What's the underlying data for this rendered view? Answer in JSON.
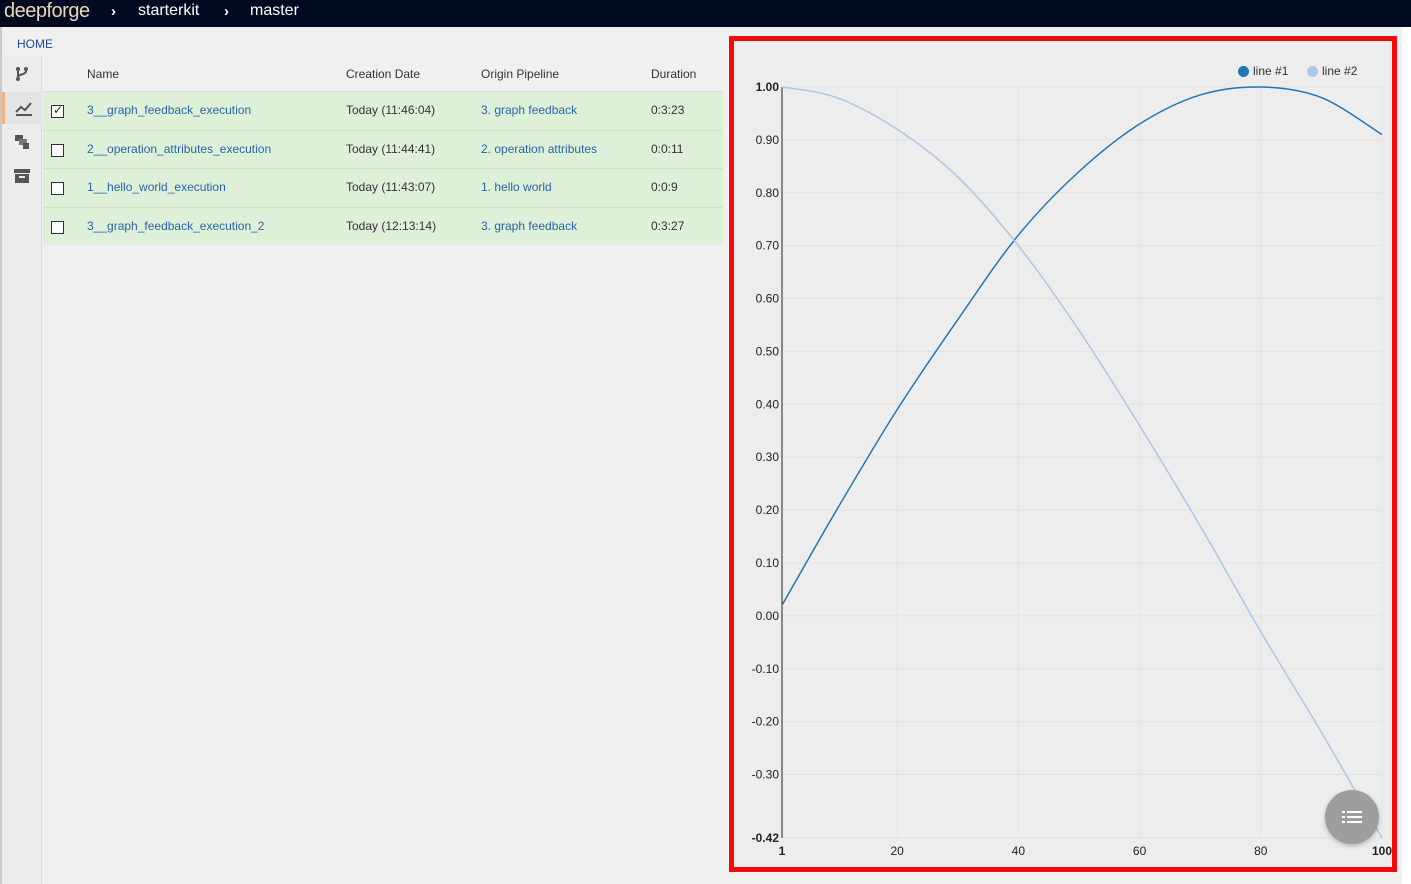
{
  "header": {
    "logo": "deepforge",
    "breadcrumbs": [
      "starterkit",
      "master"
    ]
  },
  "home_link": "HOME",
  "sidebar": {
    "items": [
      {
        "icon": "fork-icon",
        "active": false
      },
      {
        "icon": "line-chart-icon",
        "active": true
      },
      {
        "icon": "layers-icon",
        "active": false
      },
      {
        "icon": "archive-icon",
        "active": false
      }
    ]
  },
  "table": {
    "columns": [
      "Name",
      "Creation Date",
      "Origin Pipeline",
      "Duration"
    ],
    "rows": [
      {
        "checked": true,
        "name": "3__graph_feedback_execution",
        "date": "Today (11:46:04)",
        "pipeline": "3. graph feedback",
        "duration": "0:3:23"
      },
      {
        "checked": false,
        "name": "2__operation_attributes_execution",
        "date": "Today (11:44:41)",
        "pipeline": "2. operation attributes",
        "duration": "0:0:11"
      },
      {
        "checked": false,
        "name": "1__hello_world_execution",
        "date": "Today (11:43:07)",
        "pipeline": "1. hello world",
        "duration": "0:0:9"
      },
      {
        "checked": false,
        "name": "3__graph_feedback_execution_2",
        "date": "Today (12:13:14)",
        "pipeline": "3. graph feedback",
        "duration": "0:3:27"
      }
    ]
  },
  "colors": {
    "line1": "#1f77b4",
    "line2": "#aec7e8",
    "highlight_border": "#f20b0b",
    "row_bg": "#dff0d8"
  },
  "chart_data": {
    "type": "line",
    "title": "",
    "xlabel": "",
    "ylabel": "",
    "xlim": [
      1,
      100
    ],
    "ylim": [
      -0.42,
      1.0
    ],
    "x_ticks": [
      "1",
      "20",
      "40",
      "60",
      "80",
      "100"
    ],
    "y_ticks": [
      "1.00",
      "0.90",
      "0.80",
      "0.70",
      "0.60",
      "0.50",
      "0.40",
      "0.30",
      "0.20",
      "0.10",
      "0.00",
      "-0.10",
      "-0.20",
      "-0.30",
      "-0.42"
    ],
    "grid": true,
    "legend_position": "top-right",
    "series": [
      {
        "name": "line #1",
        "x": [
          1,
          10,
          20,
          30,
          40,
          50,
          60,
          70,
          80,
          90,
          100
        ],
        "values": [
          0.02,
          0.2,
          0.39,
          0.56,
          0.72,
          0.84,
          0.93,
          0.985,
          1.0,
          0.98,
          0.91
        ]
      },
      {
        "name": "line #2",
        "x": [
          1,
          10,
          20,
          30,
          40,
          50,
          60,
          70,
          80,
          90,
          100
        ],
        "values": [
          1.0,
          0.98,
          0.92,
          0.83,
          0.7,
          0.54,
          0.36,
          0.17,
          -0.03,
          -0.22,
          -0.42
        ]
      }
    ]
  }
}
